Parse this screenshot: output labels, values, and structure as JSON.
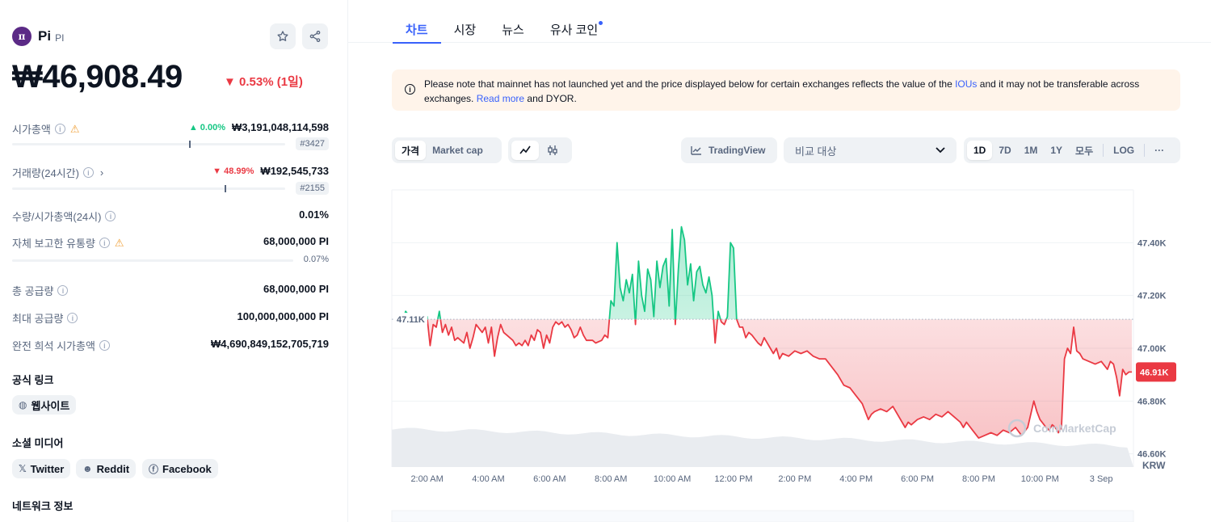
{
  "coin": {
    "logo_glyph": "π",
    "name": "Pi",
    "symbol": "PI",
    "price": "₩46,908.49",
    "change": "▼ 0.53% (1일)"
  },
  "stats": {
    "market_cap": {
      "label": "시가총액",
      "pct": "▲ 0.00%",
      "value": "₩3,191,048,114,598",
      "rank": "#3427"
    },
    "volume": {
      "label": "거래량(24시간)",
      "pct": "▼ 48.99%",
      "value": "₩192,545,733",
      "rank": "#2155"
    },
    "vol_mcap": {
      "label": "수량/시가총액(24시)",
      "value": "0.01%"
    },
    "self_supply": {
      "label": "자체 보고한 유통량",
      "value": "68,000,000 PI",
      "pct": "0.07%"
    },
    "total_supply": {
      "label": "총 공급량",
      "value": "68,000,000 PI"
    },
    "max_supply": {
      "label": "최대 공급량",
      "value": "100,000,000,000 PI"
    },
    "fdv": {
      "label": "완전 희석 시가총액",
      "value": "₩4,690,849,152,705,719"
    }
  },
  "links": {
    "official_title": "공식 링크",
    "website": "웹사이트",
    "social_title": "소셜 미디어",
    "twitter": "Twitter",
    "reddit": "Reddit",
    "facebook": "Facebook",
    "network_title": "네트워크 정보"
  },
  "tabs": [
    "차트",
    "시장",
    "뉴스",
    "유사 코인"
  ],
  "notice": {
    "text1": "Please note that mainnet has not launched yet and the price displayed below for certain exchanges reflects the value of the ",
    "ious": "IOUs",
    "text2": " and it may not be transferable across exchanges. ",
    "read_more": "Read more",
    "text3": " and DYOR."
  },
  "toolbar": {
    "price": "가격",
    "market_cap": "Market cap",
    "tradingview": "TradingView",
    "compare": "비교 대상",
    "ranges": [
      "1D",
      "7D",
      "1M",
      "1Y",
      "모두"
    ],
    "log": "LOG",
    "more": "···"
  },
  "chart_data": {
    "type": "line",
    "currency": "KRW",
    "watermark": "CoinMarketCap",
    "reference_value": 47110,
    "reference_label": "47.11K",
    "current_value": 46910,
    "current_label": "46.91K",
    "ylim": [
      46550,
      47600
    ],
    "y_ticks": [
      46600,
      46800,
      47000,
      47200,
      47400
    ],
    "y_tick_labels": [
      "46.60K",
      "46.80K",
      "47.00K",
      "47.20K",
      "47.40K"
    ],
    "x_tick_labels": [
      "2:00 AM",
      "4:00 AM",
      "6:00 AM",
      "8:00 AM",
      "10:00 AM",
      "12:00 PM",
      "2:00 PM",
      "4:00 PM",
      "6:00 PM",
      "8:00 PM",
      "10:00 PM",
      "3 Sep"
    ],
    "x_tick_hours": [
      2,
      4,
      6,
      8,
      10,
      12,
      14,
      16,
      18,
      20,
      22,
      24
    ],
    "x_start_hour": 0.85,
    "x_end_hour": 25.05,
    "points": [
      [
        1.0,
        47110
      ],
      [
        1.2,
        47100
      ],
      [
        1.3,
        47140
      ],
      [
        1.5,
        47110
      ],
      [
        1.7,
        47130
      ],
      [
        1.9,
        47100
      ],
      [
        2.0,
        47120
      ],
      [
        2.1,
        47010
      ],
      [
        2.2,
        47090
      ],
      [
        2.3,
        47080
      ],
      [
        2.4,
        47140
      ],
      [
        2.5,
        47060
      ],
      [
        2.6,
        47090
      ],
      [
        2.7,
        47050
      ],
      [
        2.8,
        47080
      ],
      [
        2.9,
        47030
      ],
      [
        3.0,
        47040
      ],
      [
        3.2,
        47020
      ],
      [
        3.3,
        47060
      ],
      [
        3.4,
        47000
      ],
      [
        3.5,
        47040
      ],
      [
        3.6,
        47090
      ],
      [
        3.8,
        47060
      ],
      [
        3.9,
        47080
      ],
      [
        4.0,
        47020
      ],
      [
        4.1,
        47080
      ],
      [
        4.2,
        46970
      ],
      [
        4.3,
        47040
      ],
      [
        4.4,
        47090
      ],
      [
        4.5,
        47060
      ],
      [
        4.6,
        47050
      ],
      [
        4.8,
        47030
      ],
      [
        4.9,
        47010
      ],
      [
        5.0,
        47020
      ],
      [
        5.1,
        47010
      ],
      [
        5.2,
        47030
      ],
      [
        5.3,
        47010
      ],
      [
        5.4,
        47050
      ],
      [
        5.5,
        47030
      ],
      [
        5.6,
        47070
      ],
      [
        5.7,
        47060
      ],
      [
        5.8,
        47000
      ],
      [
        5.9,
        47050
      ],
      [
        6.0,
        47020
      ],
      [
        6.1,
        47080
      ],
      [
        6.2,
        47100
      ],
      [
        6.3,
        47090
      ],
      [
        6.4,
        47100
      ],
      [
        6.5,
        47080
      ],
      [
        6.6,
        47090
      ],
      [
        6.7,
        47070
      ],
      [
        6.8,
        47040
      ],
      [
        6.9,
        47050
      ],
      [
        7.0,
        47080
      ],
      [
        7.1,
        47050
      ],
      [
        7.2,
        47030
      ],
      [
        7.4,
        47030
      ],
      [
        7.5,
        47020
      ],
      [
        7.7,
        47030
      ],
      [
        7.8,
        47050
      ],
      [
        7.9,
        47040
      ],
      [
        8.0,
        47180
      ],
      [
        8.1,
        47160
      ],
      [
        8.2,
        47400
      ],
      [
        8.3,
        47230
      ],
      [
        8.4,
        47180
      ],
      [
        8.5,
        47260
      ],
      [
        8.6,
        47210
      ],
      [
        8.7,
        47280
      ],
      [
        8.8,
        47090
      ],
      [
        8.9,
        47330
      ],
      [
        9.0,
        47200
      ],
      [
        9.1,
        47140
      ],
      [
        9.2,
        47300
      ],
      [
        9.3,
        47260
      ],
      [
        9.4,
        47120
      ],
      [
        9.5,
        47330
      ],
      [
        9.6,
        47230
      ],
      [
        9.7,
        47310
      ],
      [
        9.8,
        47340
      ],
      [
        9.9,
        47160
      ],
      [
        10.0,
        47450
      ],
      [
        10.1,
        47090
      ],
      [
        10.2,
        47300
      ],
      [
        10.3,
        47460
      ],
      [
        10.4,
        47410
      ],
      [
        10.5,
        47240
      ],
      [
        10.6,
        47320
      ],
      [
        10.7,
        47180
      ],
      [
        10.8,
        47290
      ],
      [
        10.9,
        47310
      ],
      [
        11.0,
        47240
      ],
      [
        11.1,
        47210
      ],
      [
        11.2,
        47270
      ],
      [
        11.3,
        47200
      ],
      [
        11.4,
        47020
      ],
      [
        11.5,
        47140
      ],
      [
        11.6,
        47100
      ],
      [
        11.7,
        47090
      ],
      [
        11.8,
        47120
      ],
      [
        11.9,
        47400
      ],
      [
        12.0,
        47380
      ],
      [
        12.1,
        47110
      ],
      [
        12.2,
        47080
      ],
      [
        12.3,
        47080
      ],
      [
        12.4,
        47040
      ],
      [
        12.5,
        47060
      ],
      [
        12.6,
        47050
      ],
      [
        12.8,
        47020
      ],
      [
        12.9,
        47010
      ],
      [
        13.0,
        47040
      ],
      [
        13.2,
        47000
      ],
      [
        13.3,
        46980
      ],
      [
        13.4,
        47000
      ],
      [
        13.5,
        46960
      ],
      [
        13.6,
        46980
      ],
      [
        13.8,
        46970
      ],
      [
        14.0,
        46990
      ],
      [
        14.2,
        46980
      ],
      [
        14.4,
        46990
      ],
      [
        14.6,
        46970
      ],
      [
        14.8,
        46960
      ],
      [
        15.0,
        46960
      ],
      [
        15.2,
        46930
      ],
      [
        15.4,
        46900
      ],
      [
        15.6,
        46860
      ],
      [
        15.8,
        46850
      ],
      [
        16.0,
        46820
      ],
      [
        16.2,
        46790
      ],
      [
        16.4,
        46730
      ],
      [
        16.5,
        46750
      ],
      [
        16.6,
        46760
      ],
      [
        16.8,
        46770
      ],
      [
        17.0,
        46760
      ],
      [
        17.2,
        46780
      ],
      [
        17.4,
        46740
      ],
      [
        17.6,
        46700
      ],
      [
        17.7,
        46720
      ],
      [
        17.8,
        46710
      ],
      [
        18.0,
        46730
      ],
      [
        18.2,
        46740
      ],
      [
        18.4,
        46730
      ],
      [
        18.6,
        46750
      ],
      [
        18.8,
        46740
      ],
      [
        19.0,
        46760
      ],
      [
        19.2,
        46740
      ],
      [
        19.4,
        46720
      ],
      [
        19.5,
        46700
      ],
      [
        19.6,
        46720
      ],
      [
        19.8,
        46690
      ],
      [
        20.0,
        46660
      ],
      [
        20.2,
        46670
      ],
      [
        20.4,
        46680
      ],
      [
        20.6,
        46670
      ],
      [
        20.8,
        46690
      ],
      [
        21.0,
        46680
      ],
      [
        21.2,
        46700
      ],
      [
        21.4,
        46670
      ],
      [
        21.6,
        46700
      ],
      [
        21.8,
        46800
      ],
      [
        21.9,
        46760
      ],
      [
        22.0,
        46730
      ],
      [
        22.2,
        46700
      ],
      [
        22.3,
        46690
      ],
      [
        22.4,
        46710
      ],
      [
        22.5,
        46700
      ],
      [
        22.6,
        46680
      ],
      [
        22.7,
        46700
      ],
      [
        22.8,
        46960
      ],
      [
        22.9,
        47000
      ],
      [
        23.0,
        46980
      ],
      [
        23.1,
        47080
      ],
      [
        23.2,
        46990
      ],
      [
        23.3,
        46980
      ],
      [
        23.4,
        46960
      ],
      [
        23.6,
        46950
      ],
      [
        23.8,
        46940
      ],
      [
        24.0,
        46950
      ],
      [
        24.2,
        46920
      ],
      [
        24.3,
        46950
      ],
      [
        24.4,
        46940
      ],
      [
        24.5,
        46890
      ],
      [
        24.6,
        46820
      ],
      [
        24.7,
        46920
      ],
      [
        24.8,
        46900
      ],
      [
        24.9,
        46910
      ],
      [
        25.0,
        46910
      ]
    ]
  }
}
